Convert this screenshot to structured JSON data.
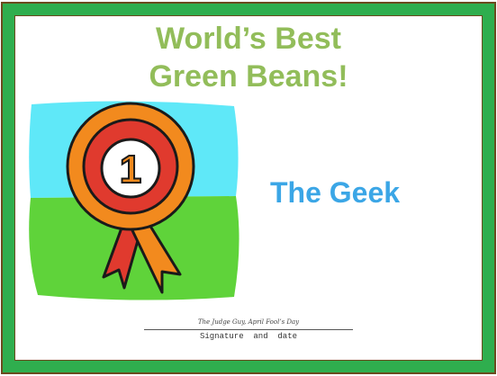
{
  "certificate": {
    "title_line1": "World’s Best",
    "title_line2": "Green Beans!",
    "recipient": "The Geek",
    "medal_number": "1",
    "signature": "The Judge Guy, April Fool’s Day",
    "signature_label": "Signature  and  date"
  },
  "colors": {
    "border": "#2fae4e",
    "title": "#92bd5a",
    "recipient": "#3ba6e6"
  }
}
